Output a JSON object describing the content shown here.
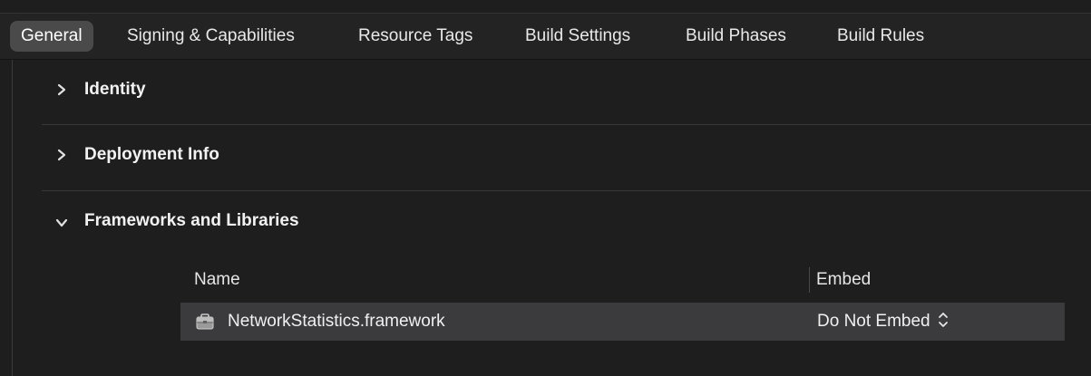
{
  "tabs": [
    {
      "label": "General",
      "active": true
    },
    {
      "label": "Signing & Capabilities",
      "active": false
    },
    {
      "label": "Resource Tags",
      "active": false
    },
    {
      "label": "Build Settings",
      "active": false
    },
    {
      "label": "Build Phases",
      "active": false
    },
    {
      "label": "Build Rules",
      "active": false
    }
  ],
  "sections": [
    {
      "title": "Identity",
      "expanded": false,
      "icon": "chevron-right-icon"
    },
    {
      "title": "Deployment Info",
      "expanded": false,
      "icon": "chevron-right-icon"
    },
    {
      "title": "Frameworks and Libraries",
      "expanded": true,
      "icon": "chevron-down-icon"
    }
  ],
  "frameworks_table": {
    "columns": [
      "Name",
      "Embed"
    ],
    "rows": [
      {
        "icon": "framework-toolbox-icon",
        "name": "NetworkStatistics.framework",
        "embed": "Do Not Embed"
      }
    ]
  },
  "colors": {
    "background": "#1e1e1e",
    "tabbar": "#232323",
    "active_tab": "#4a4a4a",
    "selected_row": "#3b3b3d",
    "text": "#e6e6e6"
  }
}
